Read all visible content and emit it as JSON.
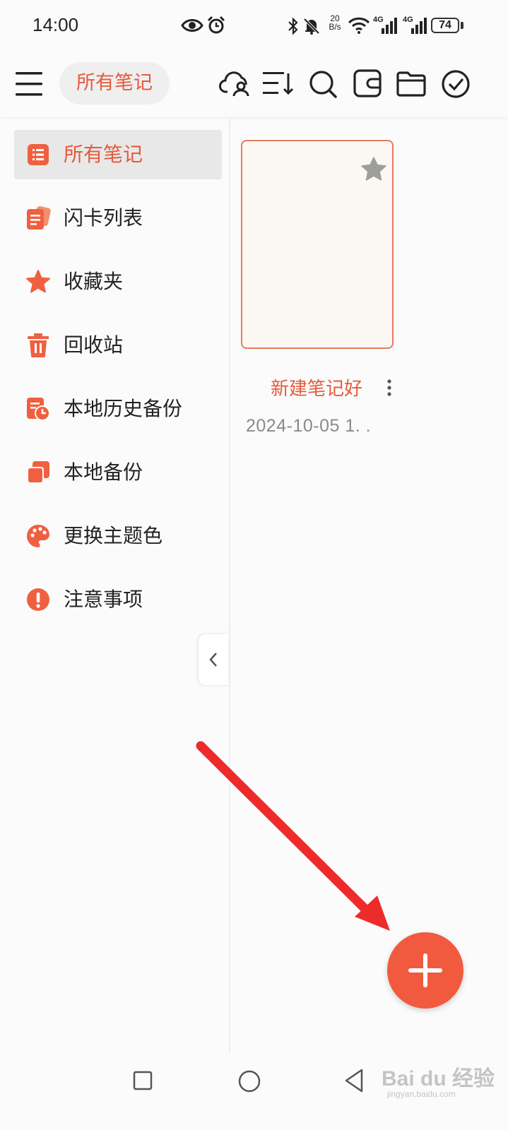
{
  "status_bar": {
    "time": "14:00",
    "net_speed_value": "20",
    "net_speed_unit": "B/s",
    "signal_1": "4G",
    "signal_2": "4G",
    "battery": "74"
  },
  "toolbar": {
    "title": "所有笔记",
    "icons": [
      "menu-icon",
      "cloud-user-icon",
      "sort-icon",
      "search-icon",
      "wallet-icon",
      "folder-icon",
      "check-circle-icon"
    ]
  },
  "sidebar": {
    "items": [
      {
        "label": "所有笔记",
        "icon": "notes-list-icon",
        "active": true
      },
      {
        "label": "闪卡列表",
        "icon": "flashcards-icon",
        "active": false
      },
      {
        "label": "收藏夹",
        "icon": "star-icon",
        "active": false
      },
      {
        "label": "回收站",
        "icon": "trash-icon",
        "active": false
      },
      {
        "label": "本地历史备份",
        "icon": "history-backup-icon",
        "active": false
      },
      {
        "label": "本地备份",
        "icon": "backup-icon",
        "active": false
      },
      {
        "label": "更换主题色",
        "icon": "palette-icon",
        "active": false
      },
      {
        "label": "注意事项",
        "icon": "alert-icon",
        "active": false
      }
    ]
  },
  "notes": [
    {
      "title": "新建笔记好",
      "date": "2024-10-05 1. ."
    }
  ],
  "colors": {
    "accent": "#e55a3c",
    "fab": "#f15a3e",
    "card_border": "#e77a5f",
    "annotation_arrow": "#ee2b2b"
  },
  "watermark": {
    "text": "Bai du 经验",
    "sub": "jingyan.baidu.com"
  }
}
